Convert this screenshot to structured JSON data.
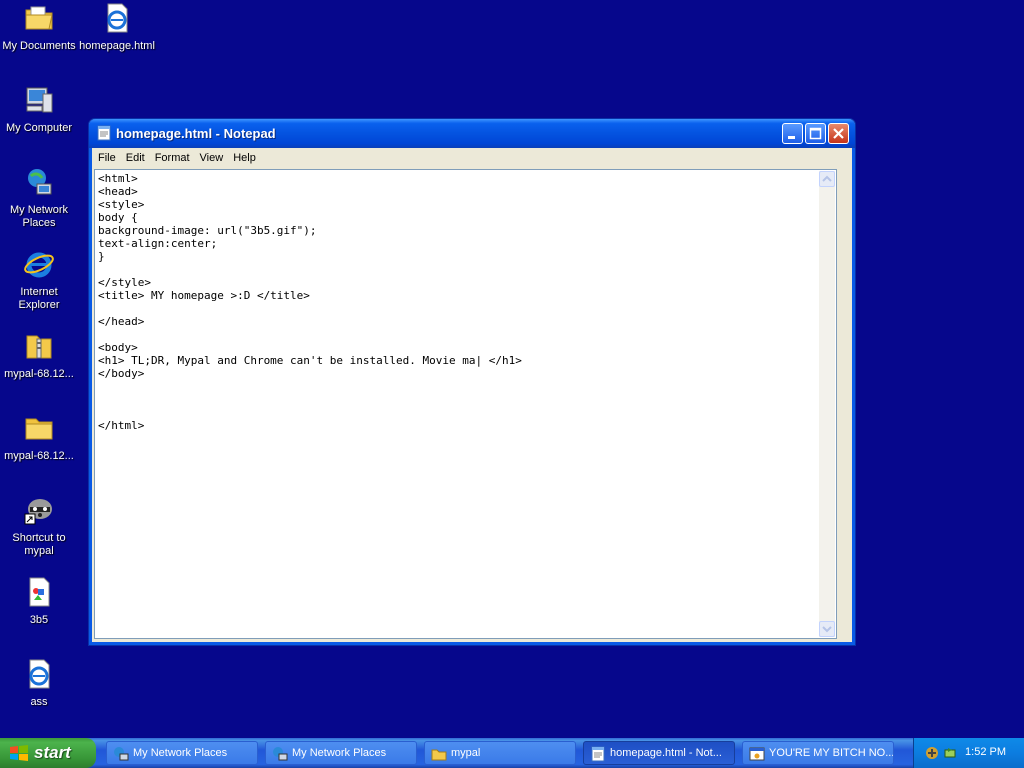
{
  "desktop": {
    "icons": [
      {
        "label": "My Documents",
        "icon": "folder-documents-icon"
      },
      {
        "label": "homepage.html",
        "icon": "ie-document-icon"
      },
      {
        "label": "My Computer",
        "icon": "computer-icon"
      },
      {
        "label": "My Network Places",
        "icon": "network-places-icon"
      },
      {
        "label": "Internet Explorer",
        "icon": "internet-explorer-icon"
      },
      {
        "label": "mypal-68.12...",
        "icon": "zip-folder-icon"
      },
      {
        "label": "mypal-68.12...",
        "icon": "folder-icon"
      },
      {
        "label": "Shortcut to mypal",
        "icon": "raccoon-shortcut-icon"
      },
      {
        "label": "3b5",
        "icon": "gif-image-icon"
      },
      {
        "label": "ass",
        "icon": "ie-document-icon"
      }
    ]
  },
  "notepad": {
    "title": "homepage.html - Notepad",
    "menu": [
      "File",
      "Edit",
      "Format",
      "View",
      "Help"
    ],
    "content": "<html>\n<head>\n<style>\nbody {\nbackground-image: url(\"3b5.gif\");\ntext-align:center;\n}\n\n</style>\n<title> MY homepage >:D </title>\n\n</head>\n\n<body>\n<h1> TL;DR, Mypal and Chrome can't be installed. Movie ma| </h1>\n</body>\n\n\n\n</html>"
  },
  "taskbar": {
    "start_label": "start",
    "tasks": [
      {
        "label": "My Network Places",
        "icon": "network-places-icon",
        "active": false
      },
      {
        "label": "My Network Places",
        "icon": "network-places-icon",
        "active": false
      },
      {
        "label": "mypal",
        "icon": "folder-icon",
        "active": false
      },
      {
        "label": "homepage.html - Not...",
        "icon": "notepad-icon",
        "active": true
      },
      {
        "label": "YOU'RE MY BITCH NO...",
        "icon": "app-window-icon",
        "active": false
      }
    ],
    "clock": "1:52 PM"
  },
  "colors": {
    "desktop_bg": "#06078c",
    "title_bar": "#0453e0",
    "taskbar": "#2157d7",
    "start_button": "#3c9a3c"
  }
}
